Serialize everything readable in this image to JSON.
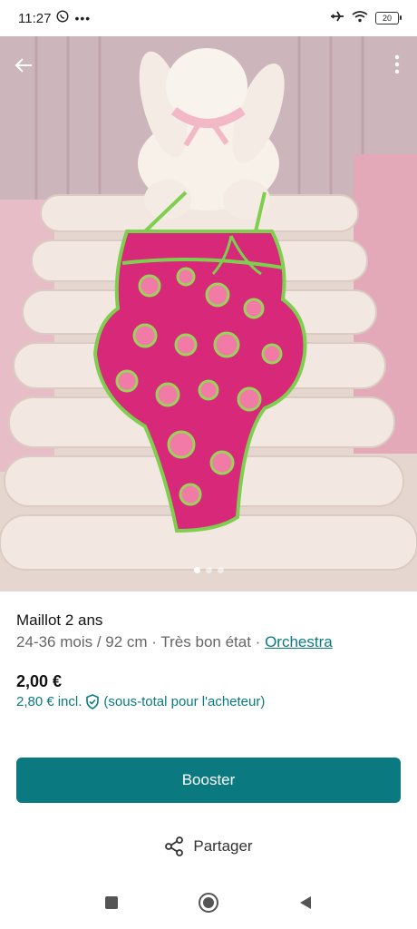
{
  "status_bar": {
    "time": "11:27",
    "whatsapp_icon": "whatsapp-icon",
    "more_icon": "more-dots-icon",
    "airplane_icon": "airplane-icon",
    "wifi_icon": "wifi-icon",
    "battery": "20"
  },
  "photo": {
    "back_icon": "arrow-left-icon",
    "more_icon": "vertical-dots-icon",
    "carousel_count": 3,
    "carousel_active": 1
  },
  "item": {
    "title": "Maillot 2 ans",
    "size": "24-36 mois / 92 cm",
    "condition": "Très bon état",
    "separator": "·",
    "brand": "Orchestra",
    "price": "2,00 €",
    "price_incl_amount": "2,80 €",
    "price_incl_label": "incl.",
    "price_incl_note": "(sous-total pour l'acheteur)"
  },
  "actions": {
    "booster_label": "Booster",
    "share_label": "Partager"
  },
  "colors": {
    "accent": "#0a7a80"
  }
}
